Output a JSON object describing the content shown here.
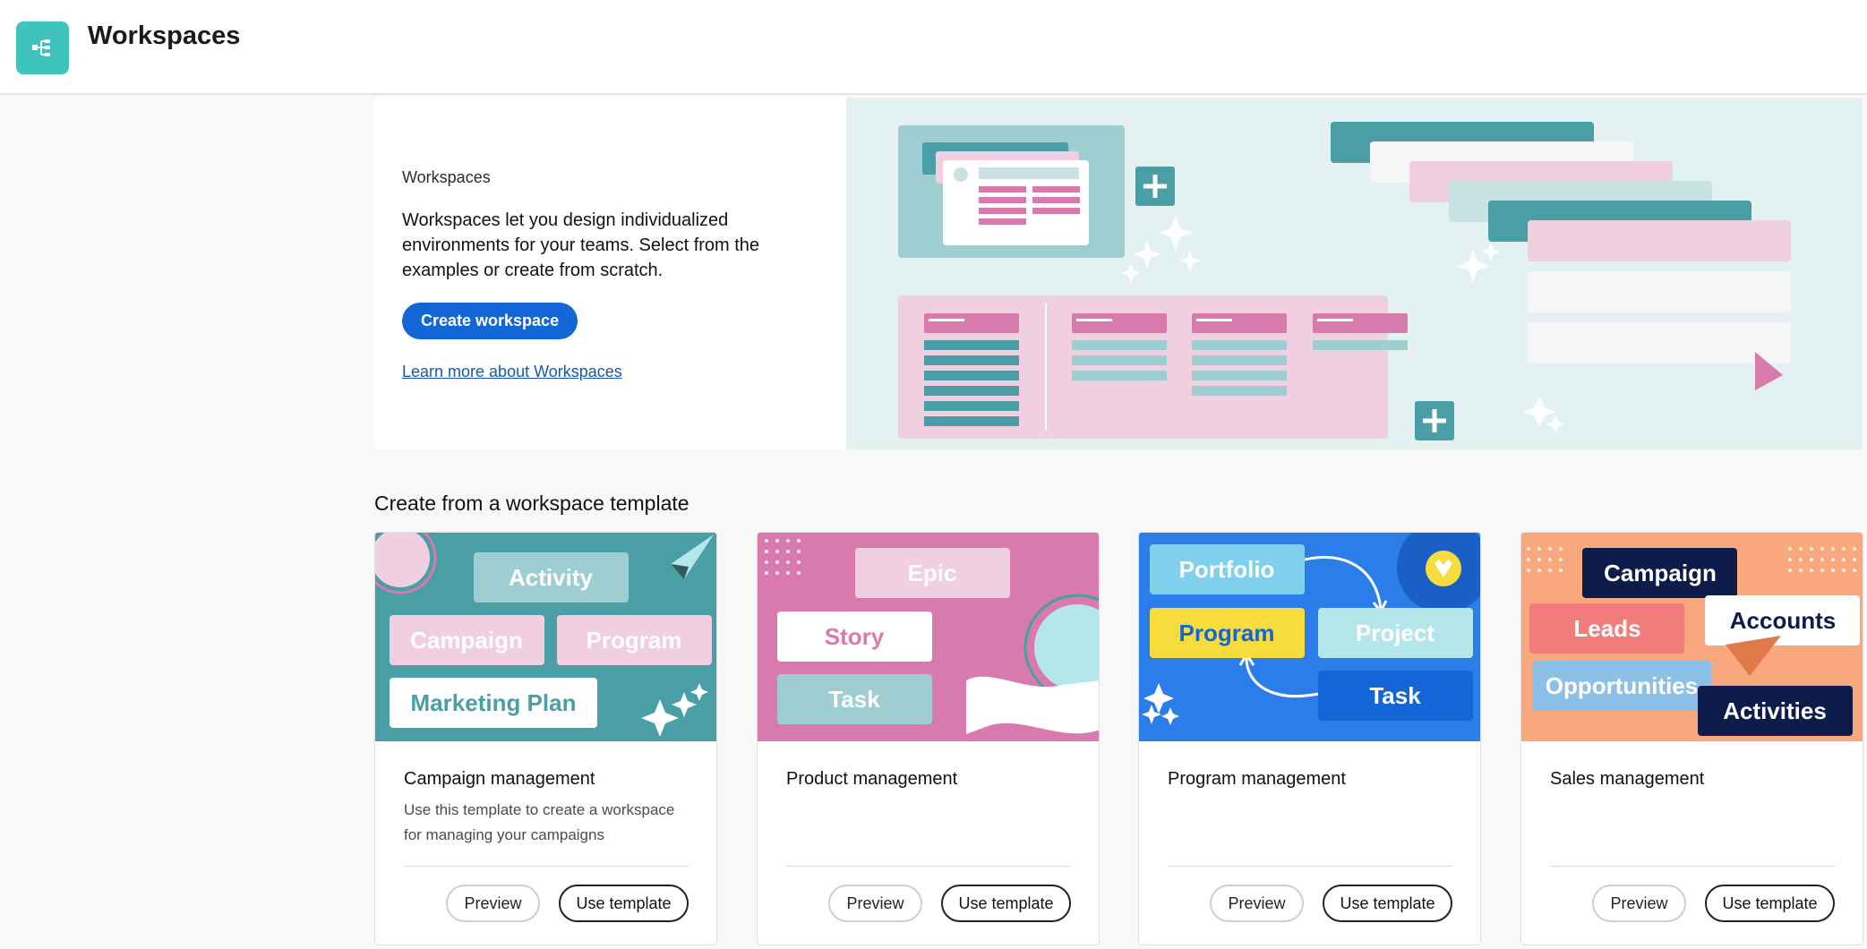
{
  "header": {
    "title": "Workspaces",
    "icon": "workspace-icon"
  },
  "hero": {
    "eyebrow": "Workspaces",
    "description": "Workspaces let you design individualized environments for your teams. Select from the examples or create from scratch.",
    "create_button": "Create workspace",
    "learn_link": "Learn more about Workspaces"
  },
  "templates": {
    "section_title": "Create from a workspace template",
    "cards": [
      {
        "title": "Campaign management",
        "description": "Use this template to create a workspace for managing your campaigns",
        "preview": "Preview",
        "use": "Use template",
        "image_labels": [
          "Activity",
          "Campaign",
          "Program",
          "Marketing Plan"
        ]
      },
      {
        "title": "Product management",
        "description": "",
        "preview": "Preview",
        "use": "Use template",
        "image_labels": [
          "Epic",
          "Story",
          "Task"
        ]
      },
      {
        "title": "Program management",
        "description": "",
        "preview": "Preview",
        "use": "Use template",
        "image_labels": [
          "Portfolio",
          "Program",
          "Project",
          "Task"
        ]
      },
      {
        "title": "Sales management",
        "description": "",
        "preview": "Preview",
        "use": "Use template",
        "image_labels": [
          "Campaign",
          "Leads",
          "Accounts",
          "Opportunities",
          "Activities"
        ]
      }
    ]
  },
  "colors": {
    "accent": "#1266d8",
    "teal": "#4a9ea5",
    "pink": "#d97aaf",
    "blue": "#2b7de9",
    "orange": "#f9a87e"
  }
}
